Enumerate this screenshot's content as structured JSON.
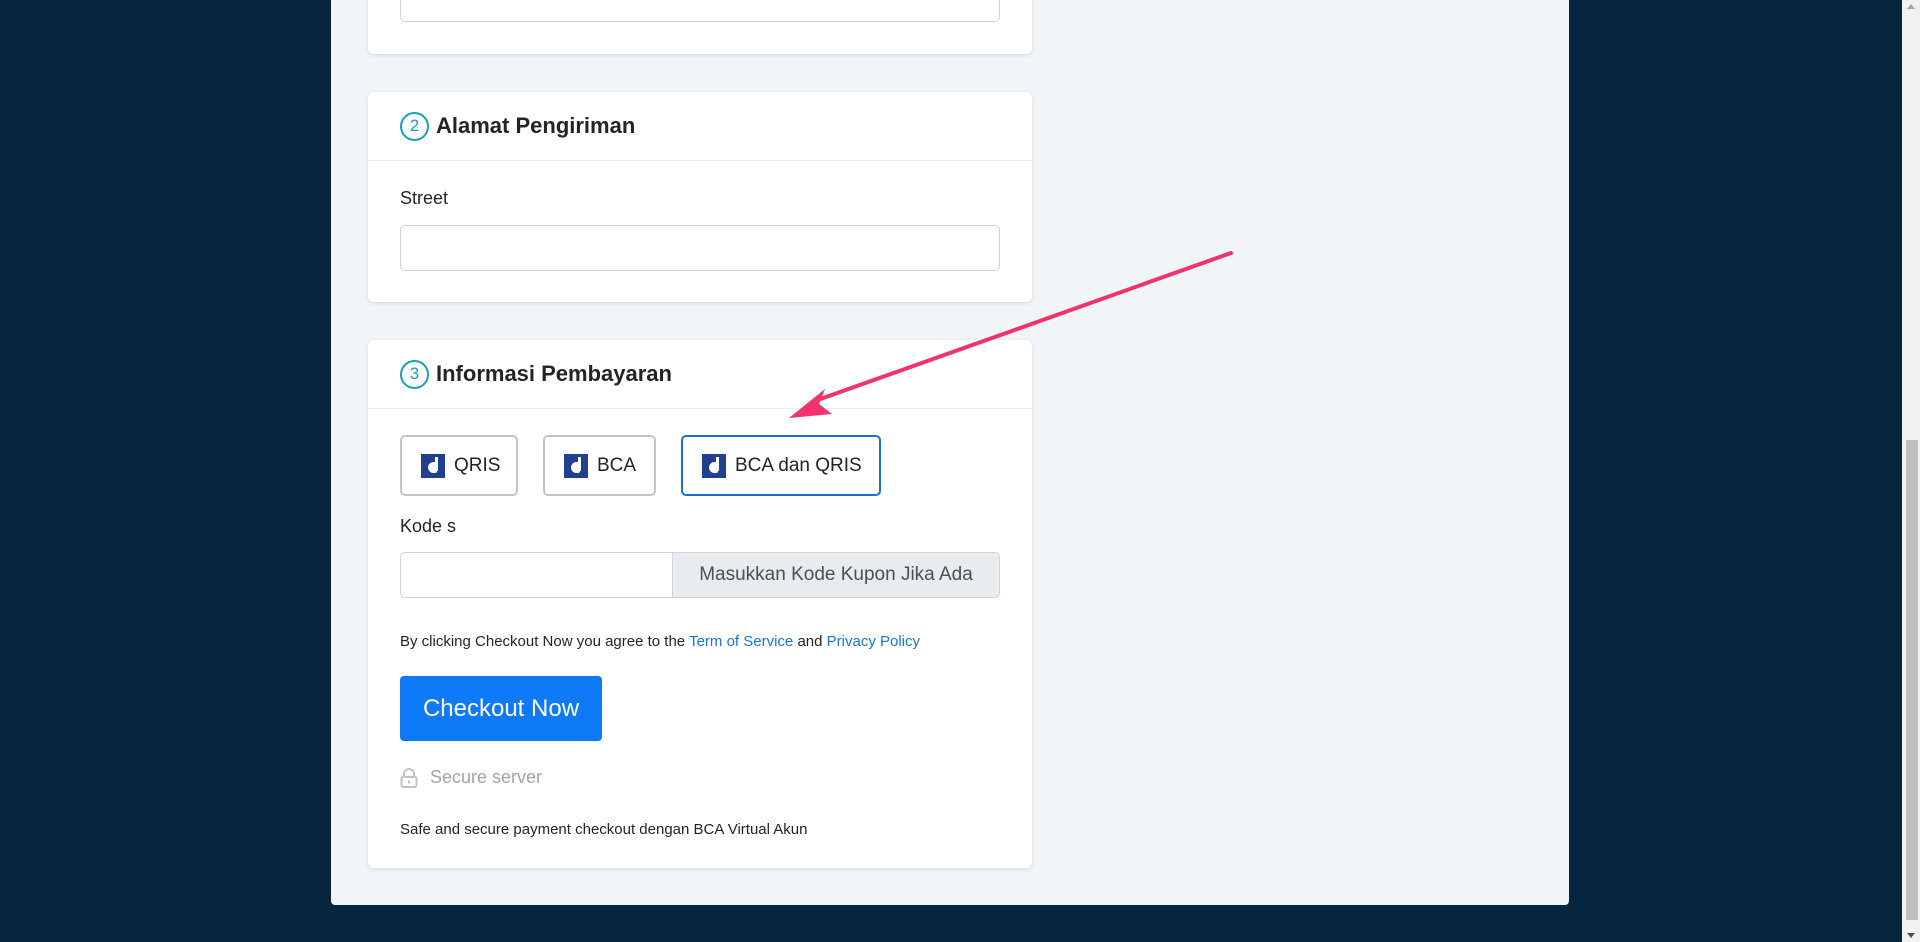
{
  "address_section": {
    "step": "2",
    "title": "Alamat Pengiriman",
    "street_label": "Street",
    "street_value": ""
  },
  "payment_section": {
    "step": "3",
    "title": "Informasi Pembayaran",
    "options": [
      {
        "label": "QRIS",
        "icon": "duitku-logo-icon",
        "selected": false
      },
      {
        "label": "BCA",
        "icon": "duitku-logo-icon",
        "selected": false
      },
      {
        "label": "BCA dan QRIS",
        "icon": "duitku-logo-icon",
        "selected": true
      }
    ],
    "coupon_label": "Kode s",
    "coupon_value": "",
    "coupon_addon": "Masukkan Kode Kupon Jika Ada",
    "agree_prefix": "By clicking Checkout Now you agree to the",
    "terms_link": "Term of Service",
    "agree_and": "and",
    "privacy_link": "Privacy Policy",
    "checkout_button": "Checkout Now",
    "secure_label": "Secure server",
    "footer_note": "Safe and secure payment checkout dengan BCA Virtual Akun"
  },
  "colors": {
    "background": "#06253f",
    "panel": "#f1f5f8",
    "accent": "#0f7af7",
    "step_circle": "#17a2b8",
    "selected_border": "#1a6fd6",
    "annotation_arrow": "#f0336b"
  }
}
